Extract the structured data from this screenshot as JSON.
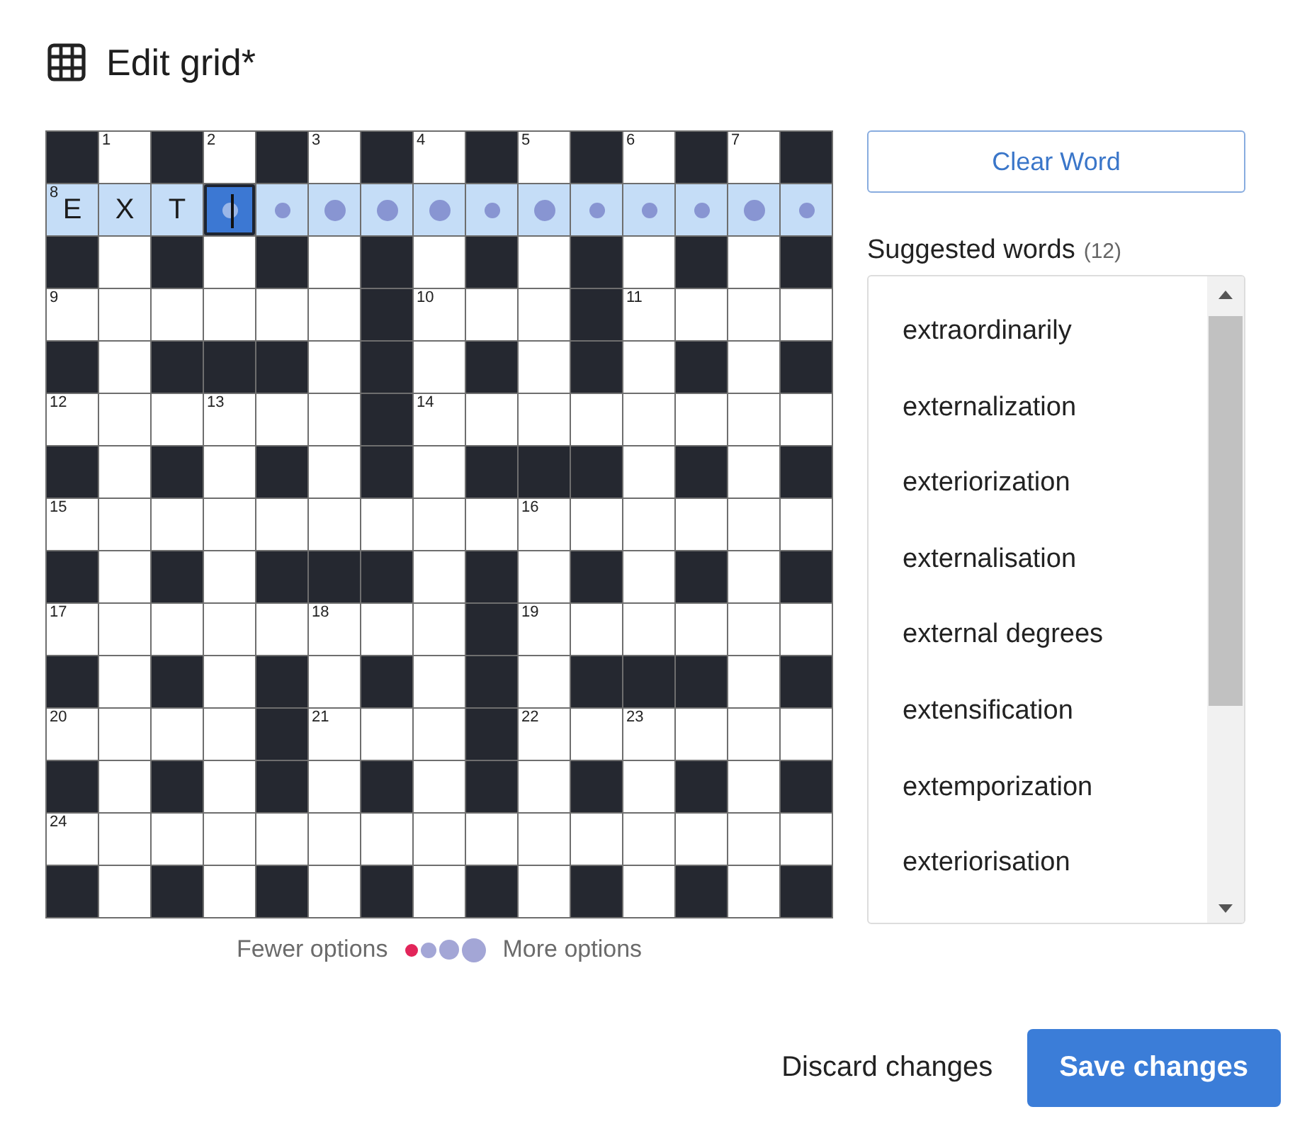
{
  "title": "Edit grid*",
  "grid": {
    "rows": [
      {
        "highlighted": false,
        "cells": [
          {
            "kind": "block"
          },
          {
            "kind": "open",
            "number": "1",
            "selected": false
          },
          {
            "kind": "block"
          },
          {
            "kind": "open",
            "number": "2",
            "selected": false
          },
          {
            "kind": "block"
          },
          {
            "kind": "open",
            "number": "3",
            "selected": false
          },
          {
            "kind": "block"
          },
          {
            "kind": "open",
            "number": "4",
            "selected": false
          },
          {
            "kind": "block"
          },
          {
            "kind": "open",
            "number": "5",
            "selected": false
          },
          {
            "kind": "block"
          },
          {
            "kind": "open",
            "number": "6",
            "selected": false
          },
          {
            "kind": "block"
          },
          {
            "kind": "open",
            "number": "7",
            "selected": false
          },
          {
            "kind": "block"
          }
        ]
      },
      {
        "highlighted": true,
        "cells": [
          {
            "kind": "open",
            "number": "8",
            "letter": "E",
            "selected": false
          },
          {
            "kind": "open",
            "letter": "X",
            "selected": false
          },
          {
            "kind": "open",
            "letter": "T",
            "selected": false
          },
          {
            "kind": "open",
            "dot_large": false,
            "selected": true
          },
          {
            "kind": "open",
            "dot_large": false,
            "selected": false
          },
          {
            "kind": "open",
            "dot_large": true,
            "selected": false
          },
          {
            "kind": "open",
            "dot_large": true,
            "selected": false
          },
          {
            "kind": "open",
            "dot_large": true,
            "selected": false
          },
          {
            "kind": "open",
            "dot_large": false,
            "selected": false
          },
          {
            "kind": "open",
            "dot_large": true,
            "selected": false
          },
          {
            "kind": "open",
            "dot_large": false,
            "selected": false
          },
          {
            "kind": "open",
            "dot_large": false,
            "selected": false
          },
          {
            "kind": "open",
            "dot_large": false,
            "selected": false
          },
          {
            "kind": "open",
            "dot_large": true,
            "selected": false
          },
          {
            "kind": "open",
            "dot_large": false,
            "selected": false
          }
        ]
      },
      {
        "highlighted": false,
        "cells": [
          {
            "kind": "block"
          },
          {
            "kind": "open",
            "selected": false
          },
          {
            "kind": "block"
          },
          {
            "kind": "open",
            "selected": false
          },
          {
            "kind": "block"
          },
          {
            "kind": "open",
            "selected": false
          },
          {
            "kind": "block"
          },
          {
            "kind": "open",
            "selected": false
          },
          {
            "kind": "block"
          },
          {
            "kind": "open",
            "selected": false
          },
          {
            "kind": "block"
          },
          {
            "kind": "open",
            "selected": false
          },
          {
            "kind": "block"
          },
          {
            "kind": "open",
            "selected": false
          },
          {
            "kind": "block"
          }
        ]
      },
      {
        "highlighted": false,
        "cells": [
          {
            "kind": "open",
            "number": "9",
            "selected": false
          },
          {
            "kind": "open",
            "selected": false
          },
          {
            "kind": "open",
            "selected": false
          },
          {
            "kind": "open",
            "selected": false
          },
          {
            "kind": "open",
            "selected": false
          },
          {
            "kind": "open",
            "selected": false
          },
          {
            "kind": "block"
          },
          {
            "kind": "open",
            "number": "10",
            "selected": false
          },
          {
            "kind": "open",
            "selected": false
          },
          {
            "kind": "open",
            "selected": false
          },
          {
            "kind": "block"
          },
          {
            "kind": "open",
            "number": "11",
            "selected": false
          },
          {
            "kind": "open",
            "selected": false
          },
          {
            "kind": "open",
            "selected": false
          },
          {
            "kind": "open",
            "selected": false
          }
        ]
      },
      {
        "highlighted": false,
        "cells": [
          {
            "kind": "block"
          },
          {
            "kind": "open",
            "selected": false
          },
          {
            "kind": "block"
          },
          {
            "kind": "block"
          },
          {
            "kind": "block"
          },
          {
            "kind": "open",
            "selected": false
          },
          {
            "kind": "block"
          },
          {
            "kind": "open",
            "selected": false
          },
          {
            "kind": "block"
          },
          {
            "kind": "open",
            "selected": false
          },
          {
            "kind": "block"
          },
          {
            "kind": "open",
            "selected": false
          },
          {
            "kind": "block"
          },
          {
            "kind": "open",
            "selected": false
          },
          {
            "kind": "block"
          }
        ]
      },
      {
        "highlighted": false,
        "cells": [
          {
            "kind": "open",
            "number": "12",
            "selected": false
          },
          {
            "kind": "open",
            "selected": false
          },
          {
            "kind": "open",
            "selected": false
          },
          {
            "kind": "open",
            "number": "13",
            "selected": false
          },
          {
            "kind": "open",
            "selected": false
          },
          {
            "kind": "open",
            "selected": false
          },
          {
            "kind": "block"
          },
          {
            "kind": "open",
            "number": "14",
            "selected": false
          },
          {
            "kind": "open",
            "selected": false
          },
          {
            "kind": "open",
            "selected": false
          },
          {
            "kind": "open",
            "selected": false
          },
          {
            "kind": "open",
            "selected": false
          },
          {
            "kind": "open",
            "selected": false
          },
          {
            "kind": "open",
            "selected": false
          },
          {
            "kind": "open",
            "selected": false
          }
        ]
      },
      {
        "highlighted": false,
        "cells": [
          {
            "kind": "block"
          },
          {
            "kind": "open",
            "selected": false
          },
          {
            "kind": "block"
          },
          {
            "kind": "open",
            "selected": false
          },
          {
            "kind": "block"
          },
          {
            "kind": "open",
            "selected": false
          },
          {
            "kind": "block"
          },
          {
            "kind": "open",
            "selected": false
          },
          {
            "kind": "block"
          },
          {
            "kind": "block"
          },
          {
            "kind": "block"
          },
          {
            "kind": "open",
            "selected": false
          },
          {
            "kind": "block"
          },
          {
            "kind": "open",
            "selected": false
          },
          {
            "kind": "block"
          }
        ]
      },
      {
        "highlighted": false,
        "cells": [
          {
            "kind": "open",
            "number": "15",
            "selected": false
          },
          {
            "kind": "open",
            "selected": false
          },
          {
            "kind": "open",
            "selected": false
          },
          {
            "kind": "open",
            "selected": false
          },
          {
            "kind": "open",
            "selected": false
          },
          {
            "kind": "open",
            "selected": false
          },
          {
            "kind": "open",
            "selected": false
          },
          {
            "kind": "open",
            "selected": false
          },
          {
            "kind": "open",
            "selected": false
          },
          {
            "kind": "open",
            "number": "16",
            "selected": false
          },
          {
            "kind": "open",
            "selected": false
          },
          {
            "kind": "open",
            "selected": false
          },
          {
            "kind": "open",
            "selected": false
          },
          {
            "kind": "open",
            "selected": false
          },
          {
            "kind": "open",
            "selected": false
          }
        ]
      },
      {
        "highlighted": false,
        "cells": [
          {
            "kind": "block"
          },
          {
            "kind": "open",
            "selected": false
          },
          {
            "kind": "block"
          },
          {
            "kind": "open",
            "selected": false
          },
          {
            "kind": "block"
          },
          {
            "kind": "block"
          },
          {
            "kind": "block"
          },
          {
            "kind": "open",
            "selected": false
          },
          {
            "kind": "block"
          },
          {
            "kind": "open",
            "selected": false
          },
          {
            "kind": "block"
          },
          {
            "kind": "open",
            "selected": false
          },
          {
            "kind": "block"
          },
          {
            "kind": "open",
            "selected": false
          },
          {
            "kind": "block"
          }
        ]
      },
      {
        "highlighted": false,
        "cells": [
          {
            "kind": "open",
            "number": "17",
            "selected": false
          },
          {
            "kind": "open",
            "selected": false
          },
          {
            "kind": "open",
            "selected": false
          },
          {
            "kind": "open",
            "selected": false
          },
          {
            "kind": "open",
            "selected": false
          },
          {
            "kind": "open",
            "number": "18",
            "selected": false
          },
          {
            "kind": "open",
            "selected": false
          },
          {
            "kind": "open",
            "selected": false
          },
          {
            "kind": "block"
          },
          {
            "kind": "open",
            "number": "19",
            "selected": false
          },
          {
            "kind": "open",
            "selected": false
          },
          {
            "kind": "open",
            "selected": false
          },
          {
            "kind": "open",
            "selected": false
          },
          {
            "kind": "open",
            "selected": false
          },
          {
            "kind": "open",
            "selected": false
          }
        ]
      },
      {
        "highlighted": false,
        "cells": [
          {
            "kind": "block"
          },
          {
            "kind": "open",
            "selected": false
          },
          {
            "kind": "block"
          },
          {
            "kind": "open",
            "selected": false
          },
          {
            "kind": "block"
          },
          {
            "kind": "open",
            "selected": false
          },
          {
            "kind": "block"
          },
          {
            "kind": "open",
            "selected": false
          },
          {
            "kind": "block"
          },
          {
            "kind": "open",
            "selected": false
          },
          {
            "kind": "block"
          },
          {
            "kind": "block"
          },
          {
            "kind": "block"
          },
          {
            "kind": "open",
            "selected": false
          },
          {
            "kind": "block"
          }
        ]
      },
      {
        "highlighted": false,
        "cells": [
          {
            "kind": "open",
            "number": "20",
            "selected": false
          },
          {
            "kind": "open",
            "selected": false
          },
          {
            "kind": "open",
            "selected": false
          },
          {
            "kind": "open",
            "selected": false
          },
          {
            "kind": "block"
          },
          {
            "kind": "open",
            "number": "21",
            "selected": false
          },
          {
            "kind": "open",
            "selected": false
          },
          {
            "kind": "open",
            "selected": false
          },
          {
            "kind": "block"
          },
          {
            "kind": "open",
            "number": "22",
            "selected": false
          },
          {
            "kind": "open",
            "selected": false
          },
          {
            "kind": "open",
            "number": "23",
            "selected": false
          },
          {
            "kind": "open",
            "selected": false
          },
          {
            "kind": "open",
            "selected": false
          },
          {
            "kind": "open",
            "selected": false
          }
        ]
      },
      {
        "highlighted": false,
        "cells": [
          {
            "kind": "block"
          },
          {
            "kind": "open",
            "selected": false
          },
          {
            "kind": "block"
          },
          {
            "kind": "open",
            "selected": false
          },
          {
            "kind": "block"
          },
          {
            "kind": "open",
            "selected": false
          },
          {
            "kind": "block"
          },
          {
            "kind": "open",
            "selected": false
          },
          {
            "kind": "block"
          },
          {
            "kind": "open",
            "selected": false
          },
          {
            "kind": "block"
          },
          {
            "kind": "open",
            "selected": false
          },
          {
            "kind": "block"
          },
          {
            "kind": "open",
            "selected": false
          },
          {
            "kind": "block"
          }
        ]
      },
      {
        "highlighted": false,
        "cells": [
          {
            "kind": "open",
            "number": "24",
            "selected": false
          },
          {
            "kind": "open",
            "selected": false
          },
          {
            "kind": "open",
            "selected": false
          },
          {
            "kind": "open",
            "selected": false
          },
          {
            "kind": "open",
            "selected": false
          },
          {
            "kind": "open",
            "selected": false
          },
          {
            "kind": "open",
            "selected": false
          },
          {
            "kind": "open",
            "selected": false
          },
          {
            "kind": "open",
            "selected": false
          },
          {
            "kind": "open",
            "selected": false
          },
          {
            "kind": "open",
            "selected": false
          },
          {
            "kind": "open",
            "selected": false
          },
          {
            "kind": "open",
            "selected": false
          },
          {
            "kind": "open",
            "selected": false
          },
          {
            "kind": "open",
            "selected": false
          }
        ]
      },
      {
        "highlighted": false,
        "cells": [
          {
            "kind": "block"
          },
          {
            "kind": "open",
            "selected": false
          },
          {
            "kind": "block"
          },
          {
            "kind": "open",
            "selected": false
          },
          {
            "kind": "block"
          },
          {
            "kind": "open",
            "selected": false
          },
          {
            "kind": "block"
          },
          {
            "kind": "open",
            "selected": false
          },
          {
            "kind": "block"
          },
          {
            "kind": "open",
            "selected": false
          },
          {
            "kind": "block"
          },
          {
            "kind": "open",
            "selected": false
          },
          {
            "kind": "block"
          },
          {
            "kind": "open",
            "selected": false
          },
          {
            "kind": "block"
          }
        ]
      }
    ]
  },
  "legend": {
    "fewer_label": "Fewer options",
    "more_label": "More options",
    "dots": [
      {
        "kind": "tiny",
        "color": "#e2255a"
      },
      {
        "kind": "small",
        "color": "#a3a6d6"
      },
      {
        "kind": "medium",
        "color": "#a3a6d6"
      },
      {
        "kind": "large",
        "color": "#a3a6d6"
      }
    ]
  },
  "clear_button": "Clear Word",
  "suggestions": {
    "heading": "Suggested words",
    "count": "(12)",
    "words": [
      "extraordinarily",
      "externalization",
      "exteriorization",
      "externalisation",
      "external degrees",
      "extensification",
      "extemporization",
      "exteriorisation"
    ]
  },
  "footer": {
    "discard": "Discard changes",
    "save": "Save changes"
  }
}
